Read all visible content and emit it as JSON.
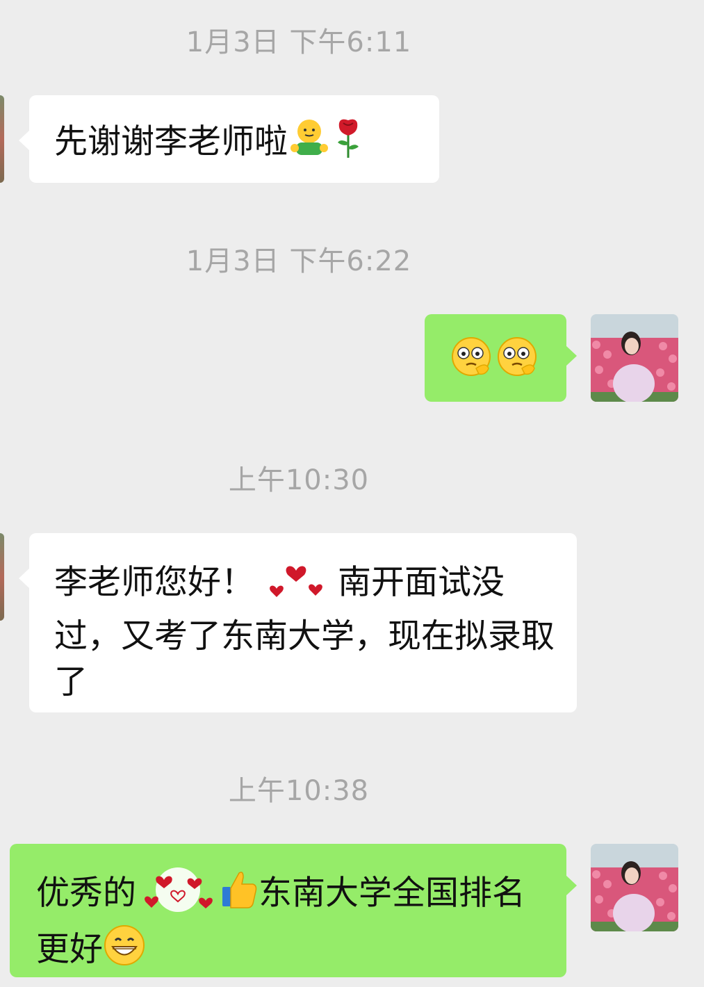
{
  "chat": {
    "messages": [
      {
        "timestamp": "1月3日 下午6:11",
        "side": "left",
        "text": "先谢谢李老师啦",
        "emojis": [
          "hug-emoji",
          "rose-emoji"
        ]
      },
      {
        "timestamp": "1月3日 下午6:22",
        "side": "right",
        "text": "",
        "emojis": [
          "thinking-face-emoji",
          "thinking-face-emoji"
        ]
      },
      {
        "timestamp": "上午10:30",
        "side": "left",
        "text_a": "李老师您好！",
        "sticker": "hearts-sticker",
        "text_b": "南开面试没过，又考了东南大学，现在拟录取了"
      },
      {
        "timestamp": "上午10:38",
        "side": "right",
        "text_a": "优秀的",
        "sticker": "hearts-sticker",
        "emoji": "thumbs-up-emoji",
        "text_b": "东南大学全国排名更好",
        "emoji_end": "grin-emoji"
      }
    ]
  },
  "colors": {
    "background": "#ededed",
    "incoming_bubble": "#ffffff",
    "outgoing_bubble": "#95ec69",
    "timestamp": "#a6a6a6"
  }
}
